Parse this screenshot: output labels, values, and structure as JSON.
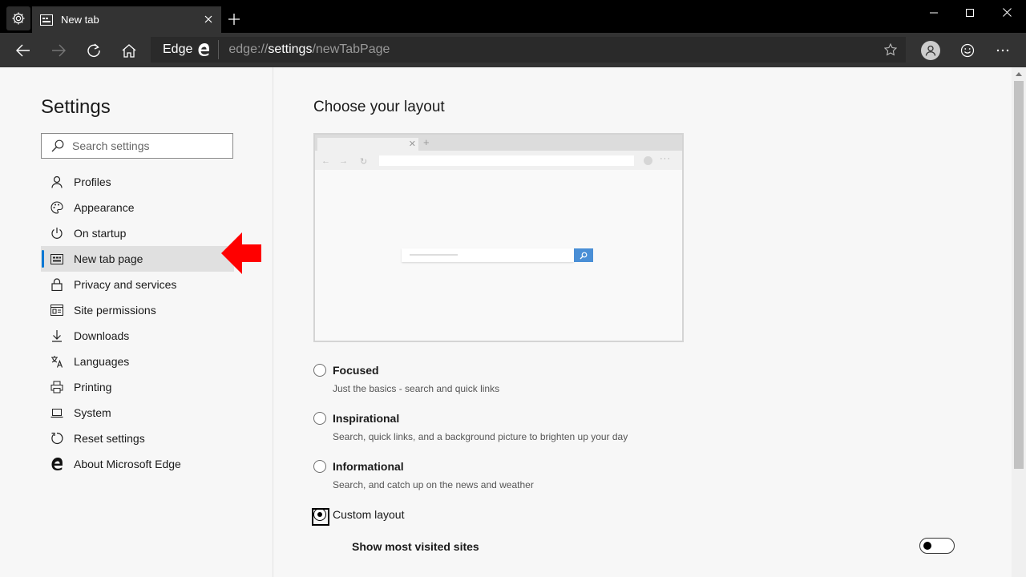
{
  "tab": {
    "title": "New tab"
  },
  "toolbar": {
    "brand": "Edge",
    "url_prefix": "edge://",
    "url_host": "settings",
    "url_path": "/newTabPage"
  },
  "sidebar": {
    "heading": "Settings",
    "search_placeholder": "Search settings",
    "items": [
      {
        "label": "Profiles",
        "icon": "person-icon"
      },
      {
        "label": "Appearance",
        "icon": "palette-icon"
      },
      {
        "label": "On startup",
        "icon": "power-icon"
      },
      {
        "label": "New tab page",
        "icon": "newtab-icon",
        "active": true
      },
      {
        "label": "Privacy and services",
        "icon": "lock-icon"
      },
      {
        "label": "Site permissions",
        "icon": "site-permissions-icon"
      },
      {
        "label": "Downloads",
        "icon": "download-icon"
      },
      {
        "label": "Languages",
        "icon": "languages-icon"
      },
      {
        "label": "Printing",
        "icon": "printer-icon"
      },
      {
        "label": "System",
        "icon": "laptop-icon"
      },
      {
        "label": "Reset settings",
        "icon": "reset-icon"
      },
      {
        "label": "About Microsoft Edge",
        "icon": "edge-logo-icon"
      }
    ]
  },
  "main": {
    "heading": "Choose your layout",
    "options": [
      {
        "name": "Focused",
        "desc": "Just the basics - search and quick links",
        "checked": false
      },
      {
        "name": "Inspirational",
        "desc": "Search, quick links, and a background picture to brighten up your day",
        "checked": false
      },
      {
        "name": "Informational",
        "desc": "Search, and catch up on the news and weather",
        "checked": false
      },
      {
        "name": "Custom layout",
        "desc": "",
        "checked": true
      }
    ],
    "toggles": [
      {
        "label": "Show most visited sites",
        "on": false
      }
    ]
  },
  "colors": {
    "accent": "#0078d4",
    "arrow": "#ff0000",
    "titlebar": "#000000",
    "toolbar": "#333333"
  }
}
